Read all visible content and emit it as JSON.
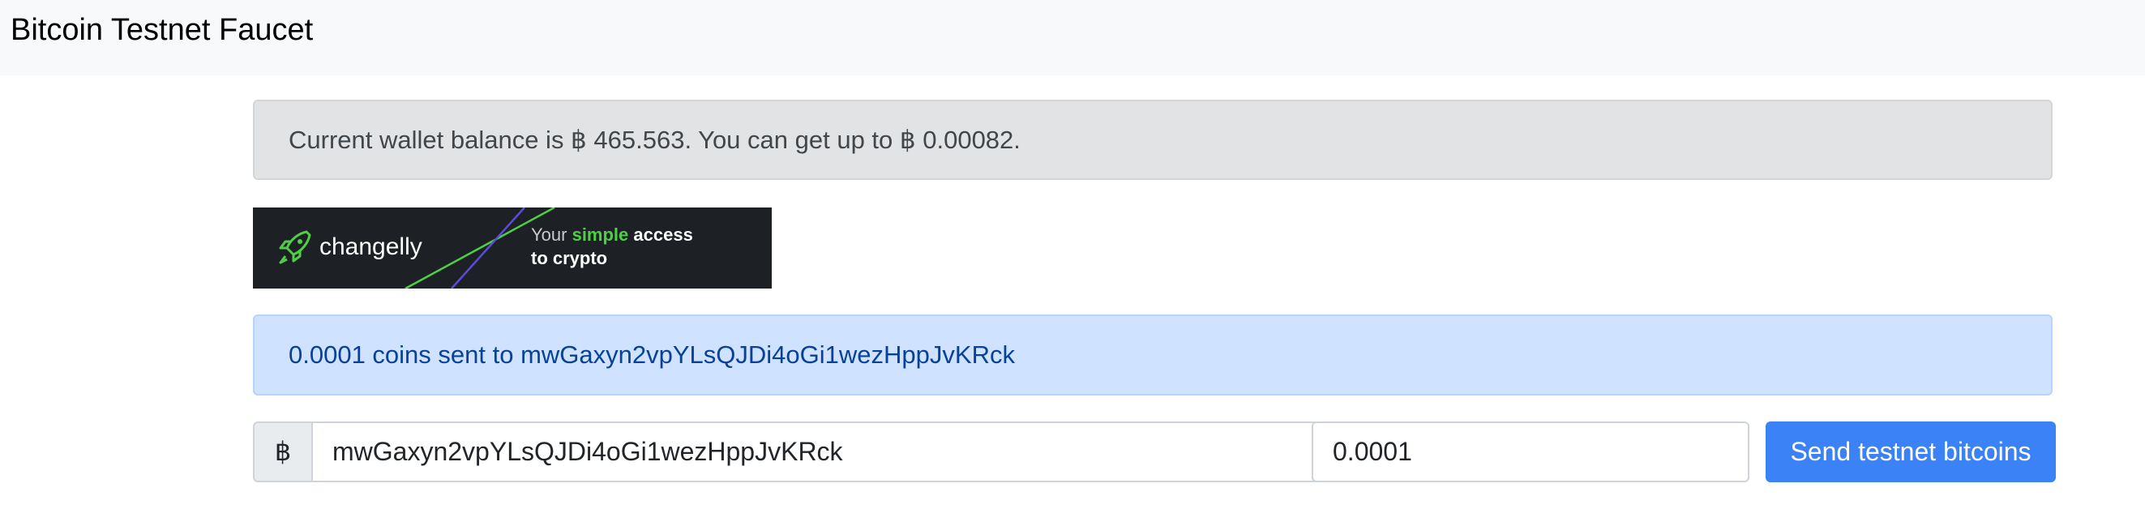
{
  "navbar": {
    "brand": "Bitcoin Testnet Faucet"
  },
  "balance_alert": {
    "text": "Current wallet balance is ฿ 465.563. You can get up to ฿ 0.00082."
  },
  "banner": {
    "logo_text": "changelly",
    "tagline_your": "Your ",
    "tagline_simple": "simple",
    "tagline_access": " access",
    "tagline_line2": "to crypto"
  },
  "sent_alert": {
    "text": "0.0001 coins sent to mwGaxyn2vpYLsQJDi4oGi1wezHppJvKRck"
  },
  "form": {
    "currency_symbol": "฿",
    "address_value": "mwGaxyn2vpYLsQJDi4oGi1wezHppJvKRck",
    "amount_value": "0.0001",
    "submit_label": "Send testnet bitcoins"
  },
  "colors": {
    "primary": "#3b82f6",
    "info_bg": "#cfe2ff",
    "secondary_bg": "#e2e3e5",
    "changelly_green": "#4fcf45"
  }
}
